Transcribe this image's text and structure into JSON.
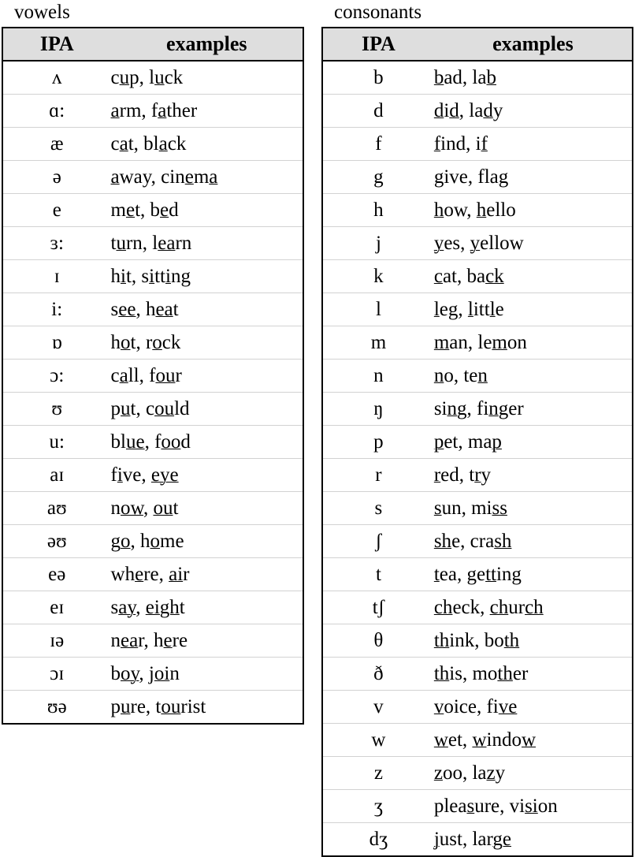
{
  "vowels": {
    "label": "vowels",
    "columns": {
      "ipa": "IPA",
      "examples": "examples"
    },
    "rows": [
      {
        "ipa": "ʌ",
        "examples": "cup, luck",
        "html": "c<u>u</u>p, l<u>u</u>ck"
      },
      {
        "ipa": "ɑ:",
        "examples": "arm, father",
        "html": "<u>a</u>rm, f<u>a</u>ther"
      },
      {
        "ipa": "æ",
        "examples": "cat, black",
        "html": "c<u>a</u>t, bl<u>a</u>ck"
      },
      {
        "ipa": "ə",
        "examples": "away, cinema",
        "html": "<u>a</u>way, cin<u>e</u>m<u>a</u>"
      },
      {
        "ipa": "e",
        "examples": "met, bed",
        "html": "m<u>e</u>t, b<u>e</u>d"
      },
      {
        "ipa": "ɜ:",
        "examples": "turn, learn",
        "html": "t<u>u</u>rn, l<u>ea</u>rn"
      },
      {
        "ipa": "ɪ",
        "examples": "hit, sitting",
        "html": "h<u>i</u>t, s<u>i</u>tt<u>i</u>ng"
      },
      {
        "ipa": "i:",
        "examples": "see, heat",
        "html": "s<u>ee</u>, h<u>ea</u>t"
      },
      {
        "ipa": "ɒ",
        "examples": "hot, rock",
        "html": "h<u>o</u>t, r<u>o</u>ck"
      },
      {
        "ipa": "ɔ:",
        "examples": "call, four",
        "html": "c<u>a</u>ll, f<u>ou</u>r"
      },
      {
        "ipa": "ʊ",
        "examples": "put, could",
        "html": "p<u>u</u>t, c<u>ou</u>ld"
      },
      {
        "ipa": "u:",
        "examples": "blue, food",
        "html": "bl<u>ue</u>, f<u>oo</u>d"
      },
      {
        "ipa": "aɪ",
        "examples": "five, eye",
        "html": "f<u>i</u>ve, <u>eye</u>"
      },
      {
        "ipa": "aʊ",
        "examples": "now, out",
        "html": "n<u>ow</u>, <u>ou</u>t"
      },
      {
        "ipa": "əʊ",
        "examples": "go, home",
        "html": "g<u>o</u>, h<u>o</u>me"
      },
      {
        "ipa": "eə",
        "examples": "where, air",
        "html": "wh<u>e</u>re, <u>ai</u>r"
      },
      {
        "ipa": "eɪ",
        "examples": "say, eight",
        "html": "s<u>ay</u>, <u>eigh</u>t"
      },
      {
        "ipa": "ɪə",
        "examples": "near, here",
        "html": "n<u>ea</u>r, h<u>e</u>re"
      },
      {
        "ipa": "ɔɪ",
        "examples": "boy, join",
        "html": "b<u>oy</u>, j<u>oi</u>n"
      },
      {
        "ipa": "ʊə",
        "examples": "pure, tourist",
        "html": "p<u>u</u>re, t<u>ou</u>rist"
      }
    ]
  },
  "consonants": {
    "label": "consonants",
    "columns": {
      "ipa": "IPA",
      "examples": "examples"
    },
    "rows": [
      {
        "ipa": "b",
        "examples": "bad, lab",
        "html": "<u>b</u>ad, la<u>b</u>"
      },
      {
        "ipa": "d",
        "examples": "did, lady",
        "html": "<u>d</u>i<u>d</u>, la<u>d</u>y"
      },
      {
        "ipa": "f",
        "examples": "find, if",
        "html": "<u>f</u>ind, i<u>f</u>"
      },
      {
        "ipa": "g",
        "examples": "give, flag",
        "html": "<u>g</u>ive, fla<u>g</u>"
      },
      {
        "ipa": "h",
        "examples": "how, hello",
        "html": "<u>h</u>ow, <u>h</u>ello"
      },
      {
        "ipa": "j",
        "examples": "yes, yellow",
        "html": "<u>y</u>es, <u>y</u>ellow"
      },
      {
        "ipa": "k",
        "examples": "cat, back",
        "html": "<u>c</u>at, ba<u>ck</u>"
      },
      {
        "ipa": "l",
        "examples": "leg, little",
        "html": "<u>l</u>eg, <u>l</u>itt<u>l</u>e"
      },
      {
        "ipa": "m",
        "examples": "man, lemon",
        "html": "<u>m</u>an, le<u>m</u>on"
      },
      {
        "ipa": "n",
        "examples": "no, ten",
        "html": "<u>n</u>o, te<u>n</u>"
      },
      {
        "ipa": "ŋ",
        "examples": "sing, finger",
        "html": "si<u>ng</u>, fi<u>n</u>ger"
      },
      {
        "ipa": "p",
        "examples": "pet, map",
        "html": "<u>p</u>et, ma<u>p</u>"
      },
      {
        "ipa": "r",
        "examples": "red, try",
        "html": "<u>r</u>ed, t<u>r</u>y"
      },
      {
        "ipa": "s",
        "examples": "sun, miss",
        "html": "<u>s</u>un, mi<u>ss</u>"
      },
      {
        "ipa": "ʃ",
        "examples": "she, crash",
        "html": "<u>sh</u>e, cra<u>sh</u>"
      },
      {
        "ipa": "t",
        "examples": "tea, getting",
        "html": "<u>t</u>ea, ge<u>tt</u>ing"
      },
      {
        "ipa": "tʃ",
        "examples": "check, church",
        "html": "<u>ch</u>eck, <u>ch</u>ur<u>ch</u>"
      },
      {
        "ipa": "θ",
        "examples": "think, both",
        "html": "<u>th</u>ink, bo<u>th</u>"
      },
      {
        "ipa": "ð",
        "examples": "this, mother",
        "html": "<u>th</u>is, mo<u>th</u>er"
      },
      {
        "ipa": "v",
        "examples": "voice, five",
        "html": "<u>v</u>oice, fi<u>ve</u>"
      },
      {
        "ipa": "w",
        "examples": "wet, window",
        "html": "<u>w</u>et, <u>w</u>indo<u>w</u>"
      },
      {
        "ipa": "z",
        "examples": "zoo, lazy",
        "html": "<u>z</u>oo, la<u>z</u>y"
      },
      {
        "ipa": "ʒ",
        "examples": "pleasure, vision",
        "html": "plea<u>s</u>ure, vi<u>si</u>on"
      },
      {
        "ipa": "dʒ",
        "examples": "just, large",
        "html": "<u>j</u>ust, lar<u>ge</u>"
      }
    ]
  },
  "colors": {
    "header_background": "#dedede",
    "border": "#000000",
    "row_separator": "#d2d2d2",
    "text": "#000000",
    "page_background": "#ffffff"
  }
}
